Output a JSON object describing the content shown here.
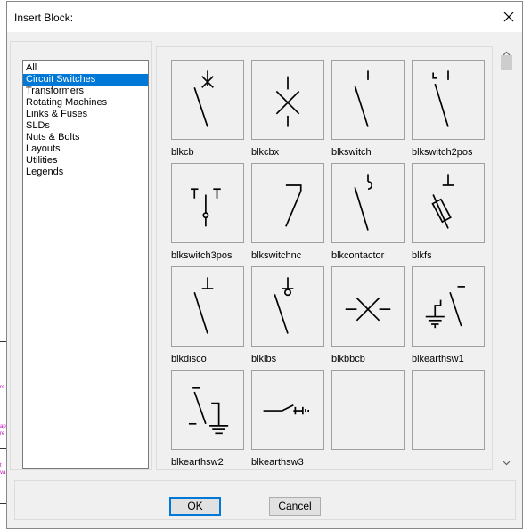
{
  "dialog": {
    "title": "Insert Block:"
  },
  "categories": [
    {
      "label": "All",
      "selected": false
    },
    {
      "label": "Circuit Switches",
      "selected": true
    },
    {
      "label": "Transformers",
      "selected": false
    },
    {
      "label": "Rotating Machines",
      "selected": false
    },
    {
      "label": "Links & Fuses",
      "selected": false
    },
    {
      "label": "SLDs",
      "selected": false
    },
    {
      "label": "Nuts & Bolts",
      "selected": false
    },
    {
      "label": "Layouts",
      "selected": false
    },
    {
      "label": "Utilities",
      "selected": false
    },
    {
      "label": "Legends",
      "selected": false
    }
  ],
  "blocks": [
    {
      "name": "blkcb"
    },
    {
      "name": "blkcbx"
    },
    {
      "name": "blkswitch"
    },
    {
      "name": "blkswitch2pos"
    },
    {
      "name": "blkswitch3pos"
    },
    {
      "name": "blkswitchnc"
    },
    {
      "name": "blkcontactor"
    },
    {
      "name": "blkfs"
    },
    {
      "name": "blkdisco"
    },
    {
      "name": "blklbs"
    },
    {
      "name": "blkbbcb"
    },
    {
      "name": "blkearthsw1"
    },
    {
      "name": "blkearthsw2"
    },
    {
      "name": "blkearthsw3"
    },
    {
      "name": ""
    },
    {
      "name": ""
    }
  ],
  "buttons": {
    "ok": "OK",
    "cancel": "Cancel"
  },
  "colors": {
    "selection": "#0078d7",
    "background_marks": "#c000c0"
  }
}
